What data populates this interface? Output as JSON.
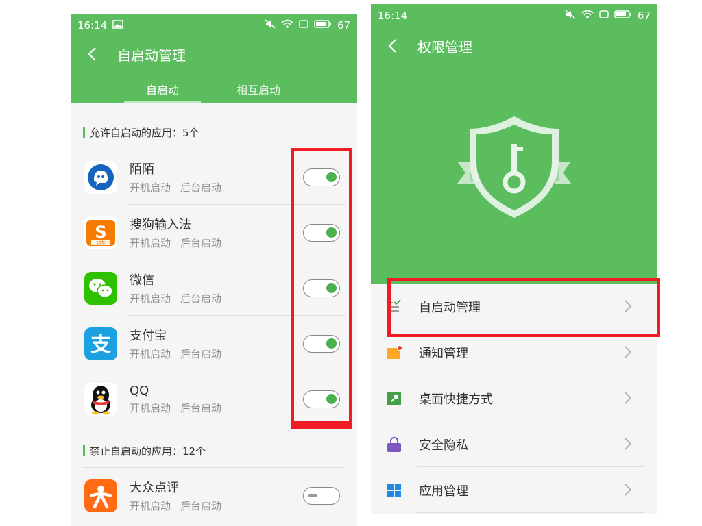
{
  "left": {
    "status": {
      "time": "16:14",
      "battery": "67"
    },
    "title": "自启动管理",
    "tabs": [
      {
        "label": "自启动",
        "active": true
      },
      {
        "label": "相互启动",
        "active": false
      }
    ],
    "allowed_section": "允许自启动的应用：5个",
    "allowed_apps": [
      {
        "name": "陌陌",
        "sub1": "开机启动",
        "sub2": "后台启动",
        "enabled": true,
        "icon": "momo-icon"
      },
      {
        "name": "搜狗输入法",
        "sub1": "开机启动",
        "sub2": "后台启动",
        "enabled": true,
        "icon": "sogou-icon",
        "badge": "10年"
      },
      {
        "name": "微信",
        "sub1": "开机启动",
        "sub2": "后台启动",
        "enabled": true,
        "icon": "wechat-icon"
      },
      {
        "name": "支付宝",
        "sub1": "开机启动",
        "sub2": "后台启动",
        "enabled": true,
        "icon": "alipay-icon"
      },
      {
        "name": "QQ",
        "sub1": "开机启动",
        "sub2": "后台启动",
        "enabled": true,
        "icon": "qq-icon"
      }
    ],
    "blocked_section": "禁止自启动的应用：12个",
    "blocked_apps": [
      {
        "name": "大众点评",
        "sub1": "开机启动",
        "sub2": "后台启动",
        "enabled": false,
        "icon": "dianping-icon"
      }
    ]
  },
  "right": {
    "status": {
      "time": "16:14",
      "battery": "67"
    },
    "title": "权限管理",
    "menu": [
      {
        "label": "自启动管理",
        "icon": "autostart-icon"
      },
      {
        "label": "通知管理",
        "icon": "notification-icon"
      },
      {
        "label": "桌面快捷方式",
        "icon": "shortcut-icon"
      },
      {
        "label": "安全隐私",
        "icon": "lock-icon"
      },
      {
        "label": "应用管理",
        "icon": "apps-grid-icon"
      }
    ]
  },
  "colors": {
    "green": "#5cbd5f",
    "highlight_red": "#ef1c23",
    "toggle_on": "#4caf50"
  }
}
